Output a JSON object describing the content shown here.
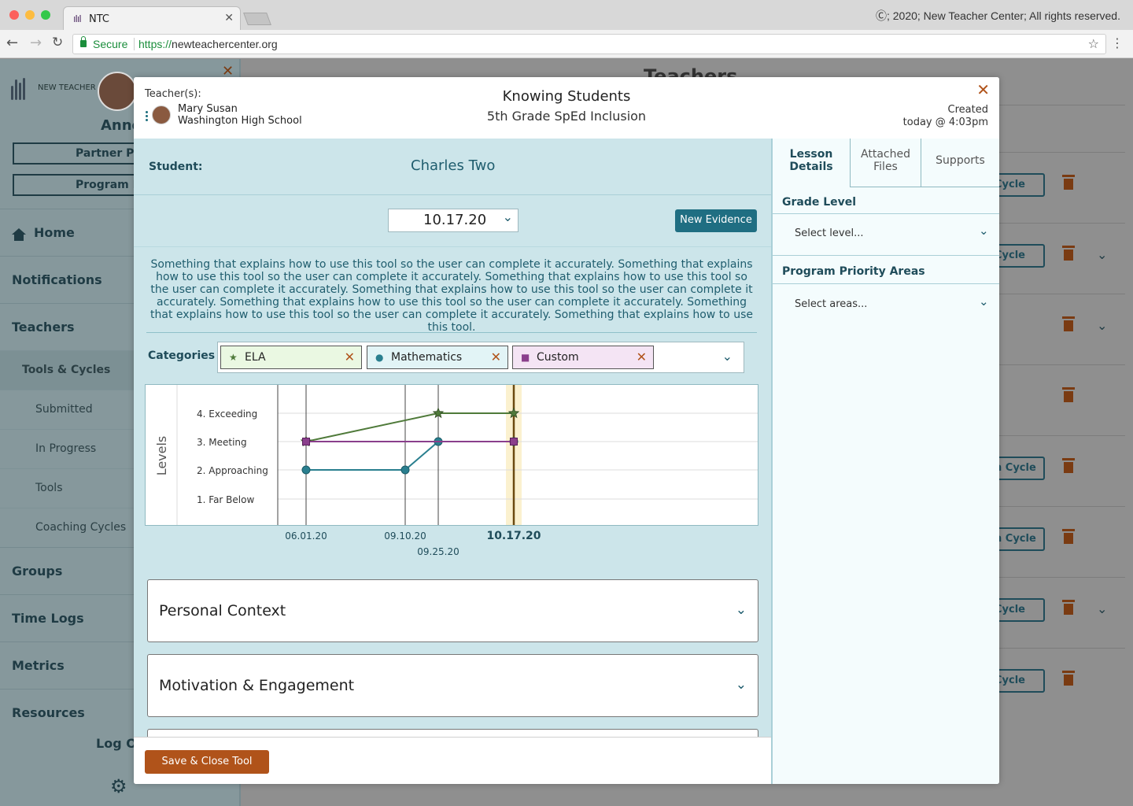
{
  "browser": {
    "tab_title": "NTC",
    "tab_logo": "ıIıI",
    "copyright": "Ⓒ; 2020; New Teacher Center; All rights reserved.",
    "secure_label": "Secure",
    "url_proto": "https://",
    "url_rest": "newteachercenter.org"
  },
  "sidebar": {
    "logo_text": "NEW TEACHER CENTER",
    "user_name": "Anne",
    "buttons": [
      "Partner Pro",
      "Program Le"
    ],
    "items": [
      "Home",
      "Notifications",
      "Teachers"
    ],
    "sub_header": "Tools & Cycles",
    "sub_items": [
      "Submitted",
      "In Progress",
      "Tools",
      "Coaching Cycles"
    ],
    "items2": [
      "Groups",
      "Time Logs",
      "Metrics",
      "Resources"
    ],
    "logout": "Log Ou"
  },
  "background": {
    "title": "Teachers",
    "cycle_label": "Cycle",
    "cycle_label_short": "n Cycle"
  },
  "modal": {
    "teacher_label": "Teacher(s):",
    "teacher_name": "Mary Susan",
    "teacher_school": "Washington High School",
    "title": "Knowing Students",
    "subtitle": "5th Grade SpEd Inclusion",
    "created_label": "Created",
    "created_time": "today @ 4:03pm",
    "student_label": "Student:",
    "student_name": "Charles Two",
    "selected_date": "10.17.20",
    "new_evidence": "New Evidence",
    "instructions": "Something that explains how to use this tool so the user can complete it accurately. Something that explains how to use this tool so the user can complete it accurately. Something that explains how to use this tool so the user can complete it accurately. Something that explains how to use this tool so the user can complete it accurately. Something that explains how to use this tool so the user can complete it accurately. Something that explains how to use this tool so the user can complete it accurately. Something that explains how to use this tool.",
    "categories_label": "Categories",
    "categories": [
      {
        "name": "ELA",
        "icon": "star-icon",
        "color": "#4f7a3a"
      },
      {
        "name": "Mathematics",
        "icon": "circle-icon",
        "color": "#2a7f8f"
      },
      {
        "name": "Custom",
        "icon": "square-icon",
        "color": "#8a3f8c"
      }
    ],
    "accordions": [
      "Personal Context",
      "Motivation & Engagement"
    ],
    "save_button": "Save & Close Tool"
  },
  "chart_data": {
    "type": "line",
    "ylabel": "Levels",
    "levels": [
      "4. Exceeding",
      "3. Meeting",
      "2. Approaching",
      "1. Far Below"
    ],
    "x": [
      "06.01.20",
      "09.10.20",
      "09.25.20",
      "10.17.20"
    ],
    "highlighted_x": "10.17.20",
    "series": [
      {
        "name": "ELA",
        "color": "#4f7a3a",
        "marker": "star",
        "points": [
          {
            "x": "06.01.20",
            "y": 3
          },
          {
            "x": "09.25.20",
            "y": 4
          },
          {
            "x": "10.17.20",
            "y": 4
          }
        ]
      },
      {
        "name": "Mathematics",
        "color": "#2a7f8f",
        "marker": "circle",
        "points": [
          {
            "x": "06.01.20",
            "y": 2
          },
          {
            "x": "09.10.20",
            "y": 2
          },
          {
            "x": "09.25.20",
            "y": 3
          },
          {
            "x": "10.17.20",
            "y": 3
          }
        ]
      },
      {
        "name": "Custom",
        "color": "#8a3f8c",
        "marker": "square",
        "points": [
          {
            "x": "06.01.20",
            "y": 3
          },
          {
            "x": "10.17.20",
            "y": 3
          }
        ]
      }
    ]
  },
  "right_panel": {
    "tabs": [
      {
        "line1": "Lesson",
        "line2": "Details"
      },
      {
        "line1": "Attached",
        "line2": "Files"
      },
      {
        "line1": "Supports",
        "line2": ""
      }
    ],
    "grade_level_title": "Grade Level",
    "grade_level_placeholder": "Select level...",
    "priority_title": "Program Priority Areas",
    "priority_placeholder": "Select areas..."
  }
}
